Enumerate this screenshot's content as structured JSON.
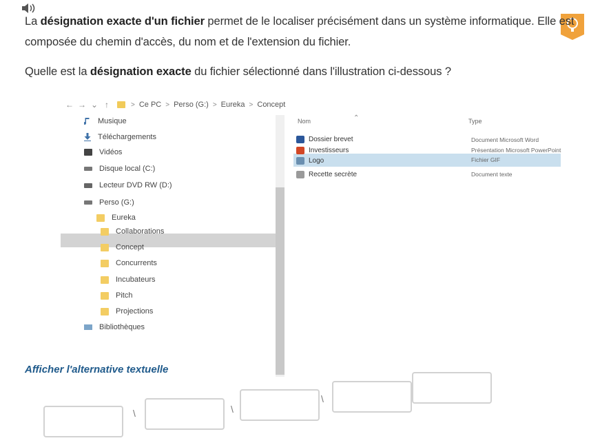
{
  "question": {
    "line1": {
      "pre": "La ",
      "bold": "désignation exacte d'un fichier",
      "post": " permet de le localiser précisément dans un système informatique. Elle est"
    },
    "line2": "composée du chemin d'accès, du nom et de l'extension du fichier.",
    "line3": {
      "pre": "Quelle est la ",
      "bold": "désignation exacte",
      "post": " du fichier sélectionné dans l'illustration ci-dessous ?"
    }
  },
  "explorer": {
    "breadcrumb": [
      "Ce PC",
      "Perso (G:)",
      "Eureka",
      "Concept"
    ],
    "breadcrumb_separator": ">",
    "sidebar": [
      {
        "label": "Musique",
        "icon": "music-icon"
      },
      {
        "label": "Téléchargements",
        "icon": "download-icon"
      },
      {
        "label": "Vidéos",
        "icon": "video-icon"
      },
      {
        "label": "Disque local (C:)",
        "icon": "drive-icon"
      },
      {
        "label": "Lecteur DVD RW (D:)",
        "icon": "dvd-icon"
      },
      {
        "label": "Perso (G:)",
        "icon": "usb-drive-icon"
      },
      {
        "label": "Eureka",
        "icon": "folder-icon"
      },
      {
        "label": "Collaborations",
        "icon": "folder-icon"
      },
      {
        "label": "Concept",
        "icon": "folder-icon",
        "selected": true
      },
      {
        "label": "Concurrents",
        "icon": "folder-icon"
      },
      {
        "label": "Incubateurs",
        "icon": "folder-icon"
      },
      {
        "label": "Pitch",
        "icon": "folder-icon"
      },
      {
        "label": "Projections",
        "icon": "folder-icon"
      },
      {
        "label": "Bibliothèques",
        "icon": "library-icon"
      }
    ],
    "columns": {
      "name": "Nom",
      "type": "Type"
    },
    "files": [
      {
        "name": "Dossier brevet",
        "type": "Document Microsoft Word",
        "icon": "word-file-icon",
        "color": "#2b579a"
      },
      {
        "name": "Investisseurs",
        "type": "Présentation Microsoft PowerPoint",
        "icon": "powerpoint-file-icon",
        "color": "#d24726"
      },
      {
        "name": "Logo",
        "type": "Fichier GIF",
        "icon": "image-file-icon",
        "color": "#6a8fb0",
        "selected": true
      },
      {
        "name": "Recette secrète",
        "type": "Document texte",
        "icon": "text-file-icon",
        "color": "#9a9a9a"
      }
    ]
  },
  "alt_link": "Afficher l'alternative textuelle",
  "answer": {
    "separators": [
      "\\",
      "\\",
      "\\",
      "."
    ]
  }
}
